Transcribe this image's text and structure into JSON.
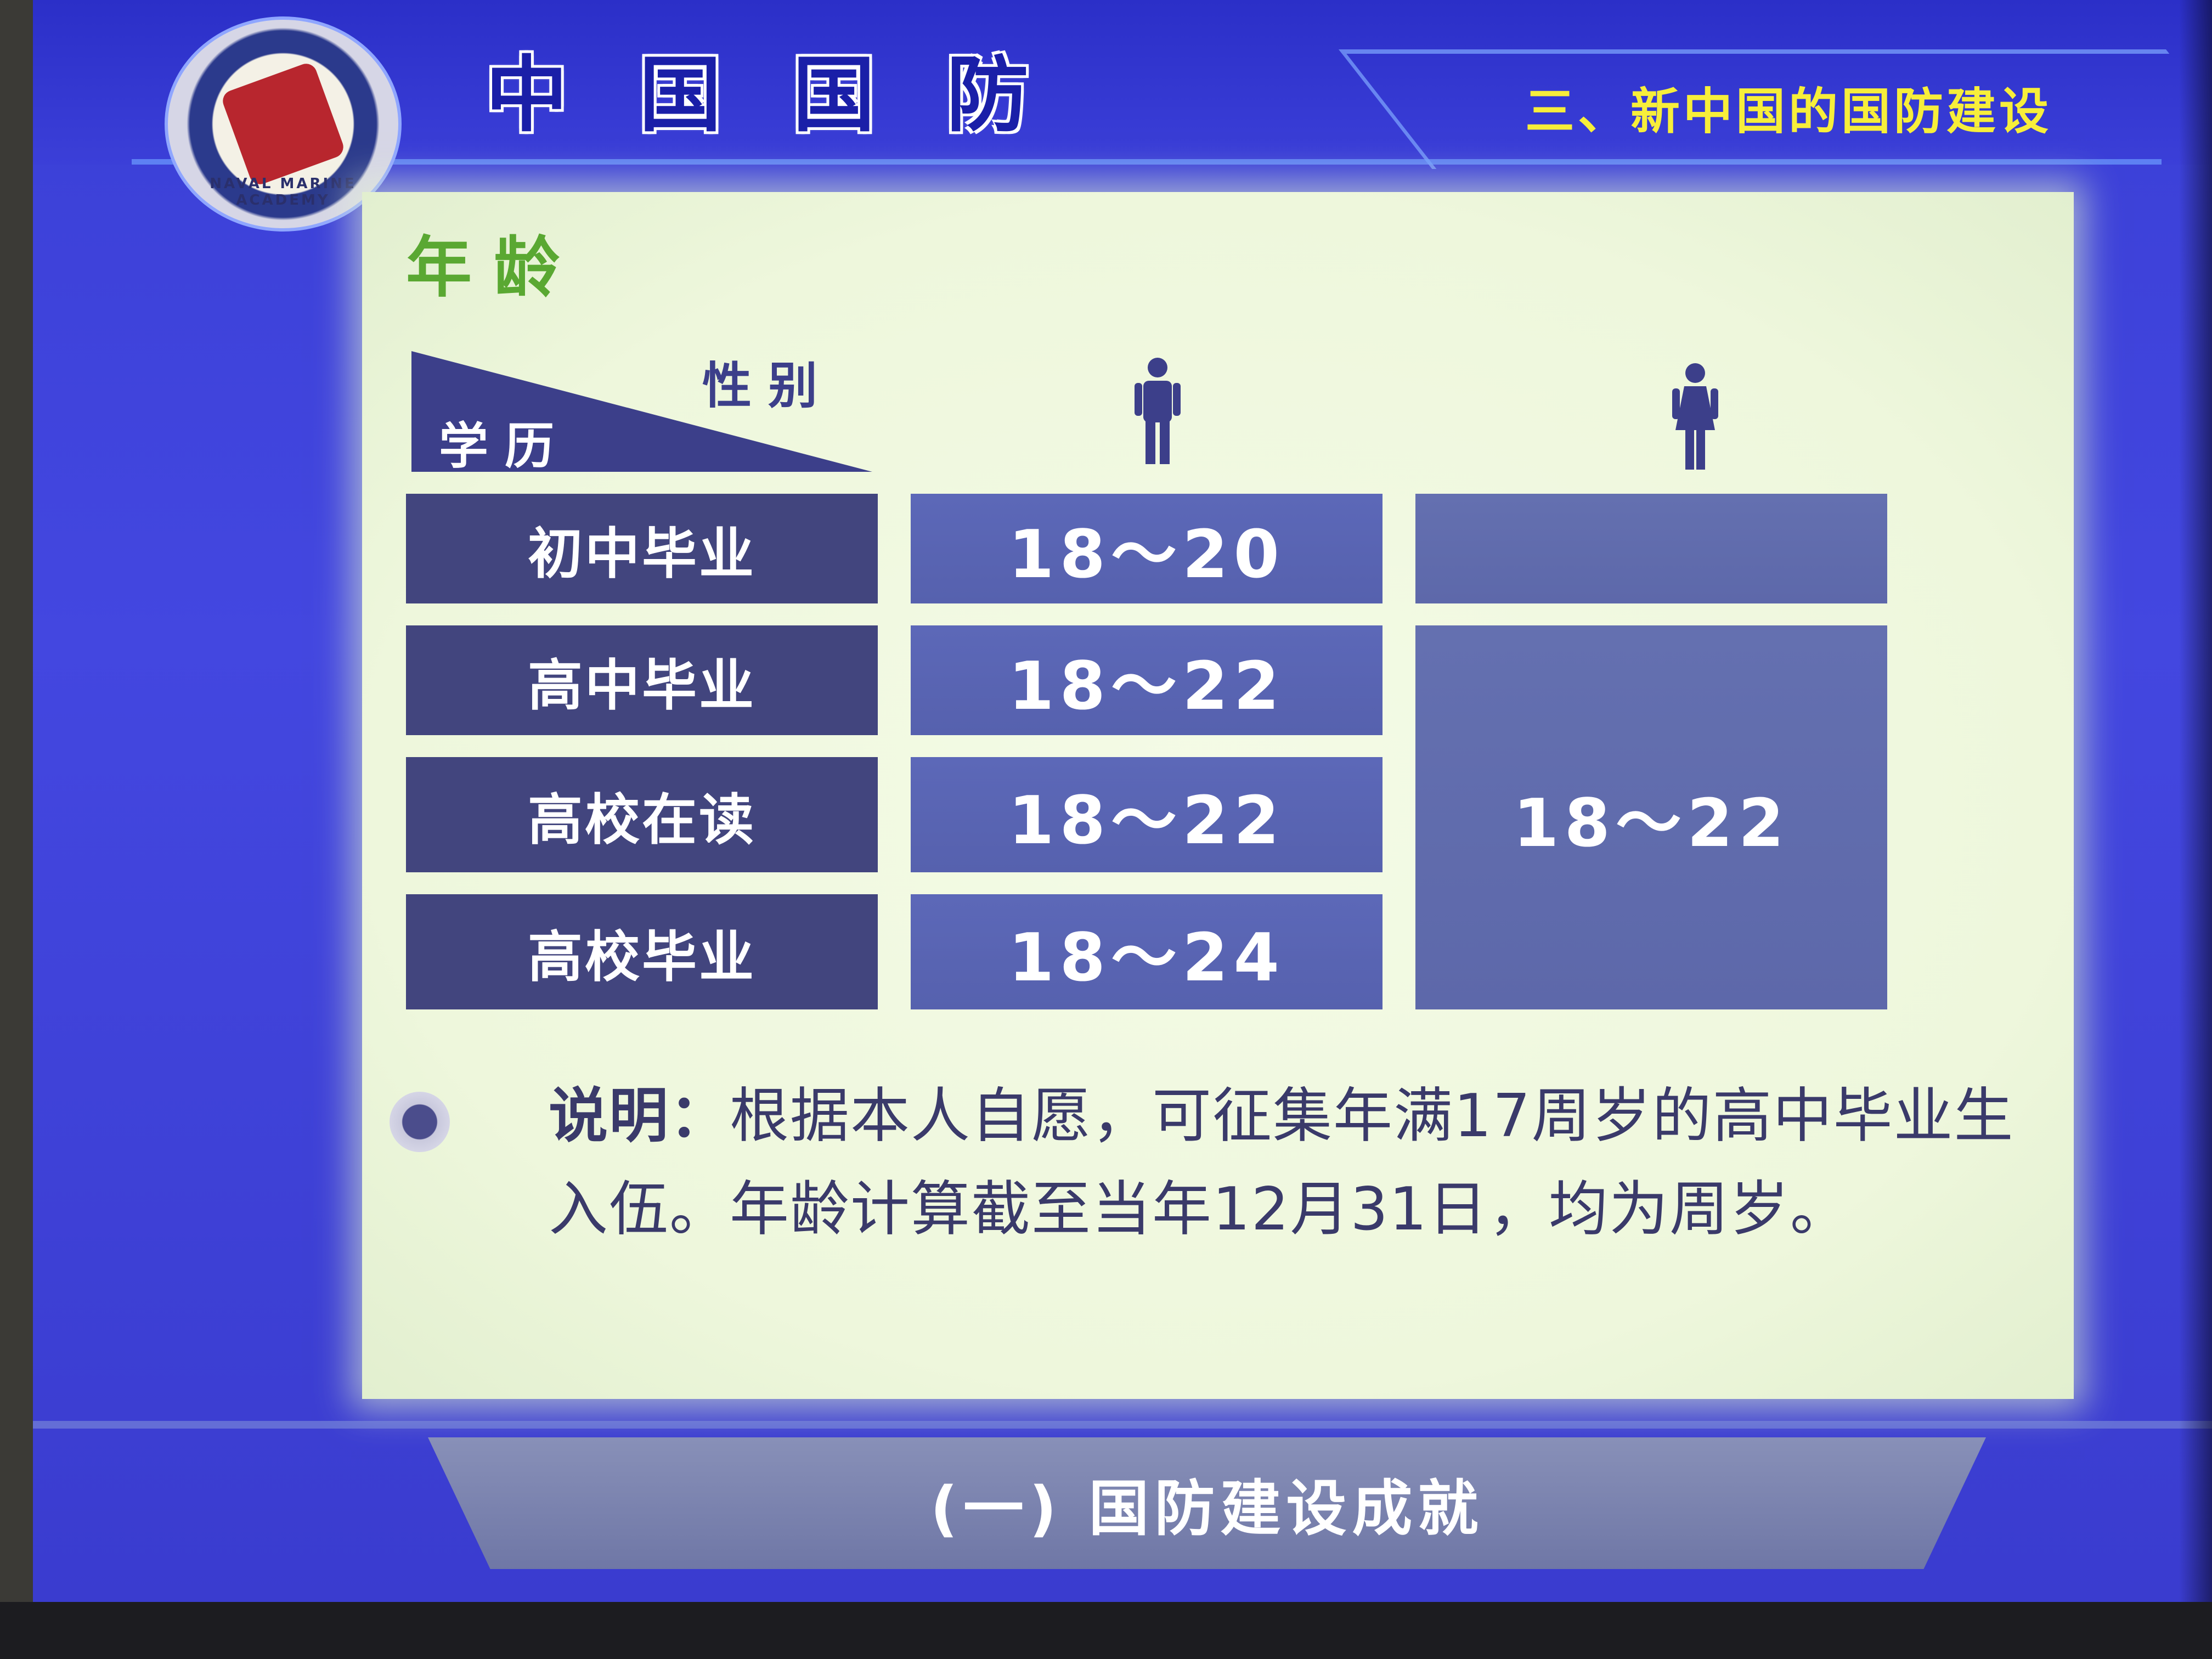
{
  "header": {
    "title_chars": [
      "中",
      "国",
      "国",
      "防"
    ],
    "subtitle": "三、新中国的国防建设",
    "logo_text": "NAVAL MARINE ACADEMY"
  },
  "section": {
    "title": "年龄"
  },
  "table": {
    "corner_top": "性别",
    "corner_bottom": "学历",
    "col_icons": [
      "male-icon",
      "female-icon"
    ],
    "rows": [
      {
        "education": "初中毕业",
        "male": "18～20"
      },
      {
        "education": "高中毕业",
        "male": "18～22"
      },
      {
        "education": "高校在读",
        "male": "18～22"
      },
      {
        "education": "高校毕业",
        "male": "18～24"
      }
    ],
    "female_empty": "",
    "female_merged": "18～22"
  },
  "note": {
    "label": "说明：",
    "text": "根据本人自愿，可征集年满17周岁的高中毕业生入伍。年龄计算截至当年12月31日，均为周岁。"
  },
  "footer": {
    "text": "(一) 国防建设成就"
  },
  "colors": {
    "slide_bg": "#4347e0",
    "title_text": "#1a1fa8",
    "subtitle_text": "#f7ee3a",
    "section_title": "#5aa832",
    "edu_cell": "#42457e",
    "value_cell": "#5c68b8",
    "panel_bg": "#f4fbe6"
  }
}
